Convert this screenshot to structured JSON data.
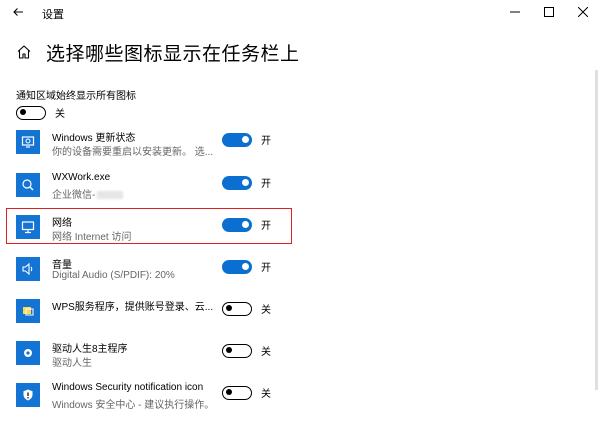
{
  "window": {
    "title": "设置",
    "controls": [
      "minimize",
      "maximize",
      "close"
    ]
  },
  "page": {
    "title": "选择哪些图标显示在任务栏上",
    "home_icon": "home-icon"
  },
  "master": {
    "label": "通知区域始终显示所有图标",
    "state": "关",
    "on": false
  },
  "items": [
    {
      "name": "Windows 更新状态",
      "desc": "你的设备需要重启以安装更新。 选...",
      "state": "开",
      "on": true,
      "icon": "update-icon"
    },
    {
      "name": "WXWork.exe",
      "desc": "企业微信-",
      "state": "开",
      "on": true,
      "icon": "wxwork-icon"
    },
    {
      "name": "网络",
      "desc": "网络 Internet 访问",
      "state": "开",
      "on": true,
      "icon": "network-icon"
    },
    {
      "name": "音量",
      "desc": "Digital Audio (S/PDIF): 20%",
      "state": "开",
      "on": true,
      "icon": "volume-icon"
    },
    {
      "name": "WPS服务程序，提供账号登录、云...",
      "desc": "",
      "state": "关",
      "on": false,
      "icon": "wps-icon"
    },
    {
      "name": "驱动人生8主程序",
      "desc": "驱动人生",
      "state": "关",
      "on": false,
      "icon": "driver-icon"
    },
    {
      "name": "Windows Security notification icon",
      "desc": "Windows 安全中心 - 建议执行操作。",
      "state": "关",
      "on": false,
      "icon": "security-icon"
    }
  ],
  "colors": {
    "accent": "#0a6fd1",
    "tile": "#1474d4",
    "highlight": "#e02020"
  }
}
